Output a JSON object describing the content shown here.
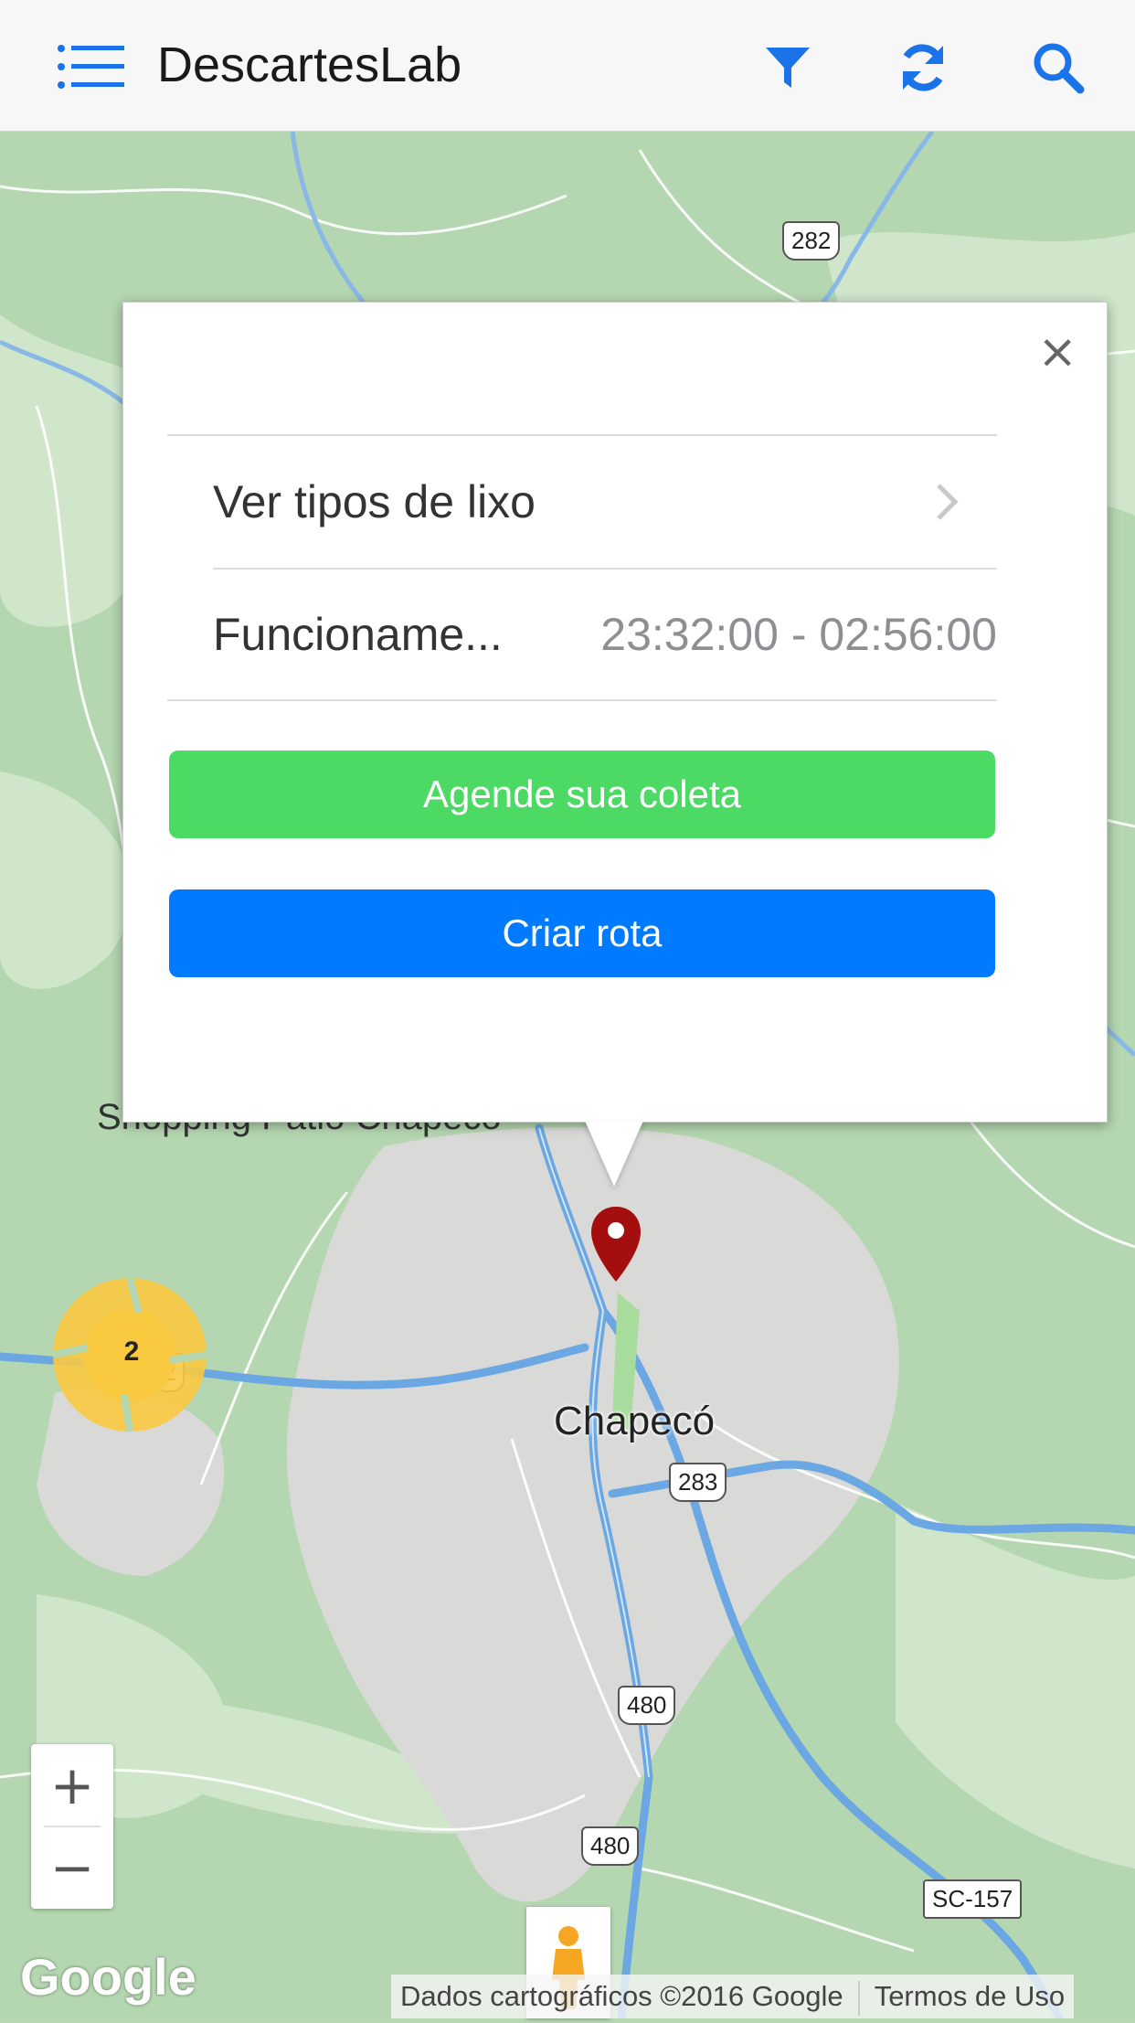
{
  "header": {
    "title": "DescartesLab",
    "icons": [
      "list-icon",
      "filter-icon",
      "refresh-icon",
      "search-icon"
    ]
  },
  "map": {
    "city": "Chapecó",
    "poi": "Shopping Patio Chapeco",
    "shields": [
      "282",
      "283",
      "480",
      "480",
      "SC-157",
      "2"
    ],
    "cluster_count": "2",
    "zoom_in": "+",
    "zoom_out": "−",
    "logo": "Google",
    "attribution": "Dados cartográficos ©2016 Google",
    "terms": "Termos de Uso"
  },
  "popup": {
    "close": "×",
    "row1_label": "Ver tipos de lixo",
    "row2_label": "Funcioname...",
    "row2_value": "23:32:00 - 02:56:00",
    "button_schedule": "Agende sua coleta",
    "button_route": "Criar rota"
  },
  "colors": {
    "accent": "#007aff",
    "green": "#4cd964",
    "marker": "#a50e0e",
    "cluster": "#f9c940"
  }
}
